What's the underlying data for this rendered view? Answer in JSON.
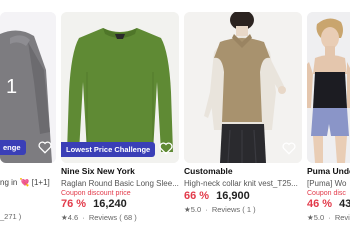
{
  "products": [
    {
      "brand": "",
      "title": "ng in 💘 [1+1]",
      "coupon": "",
      "discount": "",
      "price": "",
      "rating": "",
      "reviews": "_271 )",
      "badge": "enge",
      "overlay_text": "1",
      "colors": {
        "image": "#7d7c80"
      }
    },
    {
      "brand": "Nine Six New York",
      "title": "Raglan Round Basic Long Slee...",
      "coupon": "Coupon discount price",
      "discount": "76 %",
      "price": "16,240",
      "rating": "★4.6",
      "reviews": "Reviews ( 68 )",
      "badge": "Lowest Price Challenge",
      "colors": {
        "image": "#5f8a34"
      }
    },
    {
      "brand": "Customable",
      "title": "High-neck collar knit vest_T25...",
      "coupon": "",
      "discount": "66 %",
      "price": "16,900",
      "rating": "★5.0",
      "reviews": "Reviews ( 1 )",
      "badge": "",
      "colors": {
        "image": "#a8926e"
      }
    },
    {
      "brand": "Puma Unde",
      "title": "[Puma] Wo",
      "coupon": "Coupon disc",
      "discount": "46 %",
      "price": "43",
      "rating": "★5.0",
      "reviews": "Revie",
      "badge": "",
      "colors": {
        "image": "#8a95c8"
      }
    }
  ],
  "colors": {
    "accent_red": "#e23a4a",
    "badge_bg": "#3a3fb7"
  },
  "icons": {
    "wishlist": "heart-outline-icon"
  }
}
